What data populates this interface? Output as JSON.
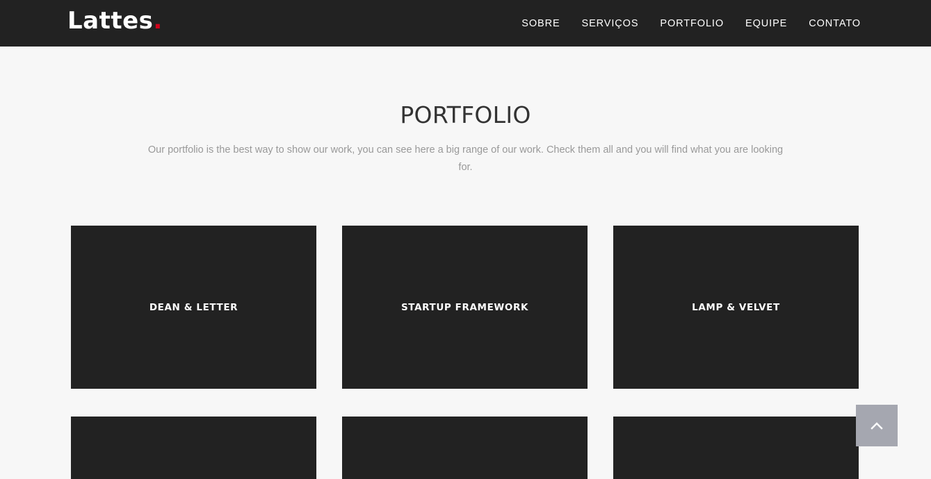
{
  "brand": {
    "name": "Lattes",
    "dot": ".",
    "dot_color": "#d0021b"
  },
  "nav": {
    "items": [
      {
        "label": "SOBRE"
      },
      {
        "label": "SERVIÇOS"
      },
      {
        "label": "PORTFOLIO"
      },
      {
        "label": "EQUIPE"
      },
      {
        "label": "CONTATO"
      }
    ]
  },
  "portfolio": {
    "title": "PORTFOLIO",
    "description": "Our portfolio is the best way to show our work, you can see here a big range of our work. Check them all and you will find what you are looking for.",
    "items": [
      {
        "caption": "DEAN & LETTER"
      },
      {
        "caption": "STARTUP FRAMEWORK"
      },
      {
        "caption": "LAMP & VELVET"
      },
      {
        "caption": ""
      },
      {
        "caption": ""
      },
      {
        "caption": ""
      }
    ]
  },
  "back_to_top": {
    "icon": "chevron-up-icon"
  },
  "colors": {
    "navbar_bg": "#222222",
    "page_bg": "#f7f7f7",
    "accent": "#d0021b",
    "tile_bg": "#222222",
    "back_to_top_bg": "#a5a7b0"
  }
}
